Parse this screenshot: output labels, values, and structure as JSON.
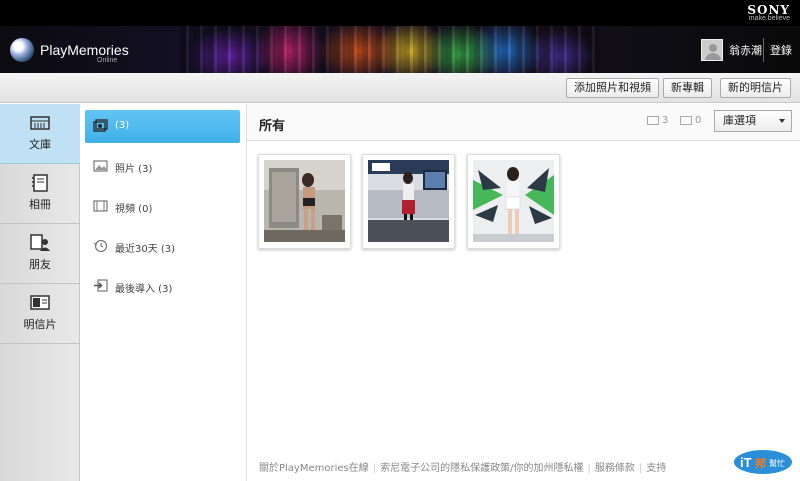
{
  "header": {
    "brand": "SONY",
    "brand_tagline": "make.believe",
    "app_title": "PlayMemories",
    "app_subtitle": "Online",
    "username": "翁赤潮",
    "login_label": "登錄"
  },
  "toolbar": {
    "add_media_label": "添加照片和視頻",
    "new_album_label": "新專輯",
    "new_postcard_label": "新的明信片"
  },
  "sidebar": {
    "items": [
      {
        "label": "文庫",
        "icon": "library-icon",
        "active": true
      },
      {
        "label": "相冊",
        "icon": "album-icon",
        "active": false
      },
      {
        "label": "朋友",
        "icon": "friends-icon",
        "active": false
      },
      {
        "label": "明信片",
        "icon": "postcard-icon",
        "active": false
      }
    ]
  },
  "filters": {
    "items": [
      {
        "label": "(3)",
        "icon": "all-media-icon",
        "active": true
      },
      {
        "label": "照片 (3)",
        "icon": "photo-icon",
        "active": false
      },
      {
        "label": "視頻 (0)",
        "icon": "video-icon",
        "active": false
      },
      {
        "label": "最近30天 (3)",
        "icon": "clock-icon",
        "active": false
      },
      {
        "label": "最後導入 (3)",
        "icon": "import-icon",
        "active": false
      }
    ]
  },
  "main": {
    "title": "所有",
    "photo_count": "3",
    "video_count": "0",
    "sort_select": "庫選項",
    "thumbnails": [
      {
        "name": "photo-mirror-selfie"
      },
      {
        "name": "photo-expo-booth"
      },
      {
        "name": "photo-showgirl-stage"
      }
    ]
  },
  "footer": {
    "about": "關於PlayMemories在線",
    "privacy": "索尼電子公司的隱私保護政策/你的加州隱私權",
    "terms": "服務條款",
    "support": "支持"
  },
  "watermark": {
    "text_left": "iT",
    "text_mid": "邦",
    "text_right": "幫忙"
  },
  "colors": {
    "accent": "#3fb0e8",
    "sidebar_active": "#bfe1f3"
  }
}
